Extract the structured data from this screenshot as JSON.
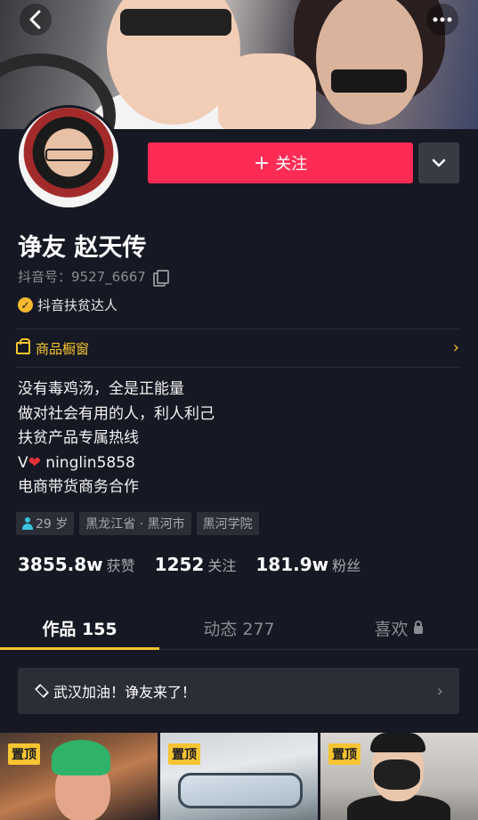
{
  "header": {
    "back_icon": "chevron-left-icon",
    "more_icon": "more-dots-icon"
  },
  "actions": {
    "follow_label": "关注",
    "dropdown_icon": "chevron-down-icon"
  },
  "profile": {
    "name": "诤友 赵天传",
    "douyin_id": "抖音号：9527_6667",
    "badge": "抖音扶贫达人",
    "shop_label": "商品橱窗",
    "bio_lines": [
      "没有毒鸡汤，全是正能量",
      "做对社会有用的人，利人利己",
      "扶贫产品专属热线",
      "V",
      "ninglin5858",
      "电商带货商务合作"
    ],
    "tags": {
      "age": "29 岁",
      "location": "黑龙江省 · 黑河市",
      "school": "黑河学院"
    },
    "stats": [
      {
        "value": "3855.8w",
        "label": "获赞"
      },
      {
        "value": "1252",
        "label": "关注"
      },
      {
        "value": "181.9w",
        "label": "粉丝"
      }
    ]
  },
  "tabs": [
    {
      "label": "作品 155",
      "active": true
    },
    {
      "label": "动态 277",
      "active": false
    },
    {
      "label": "喜欢",
      "active": false,
      "icon": "lock-icon"
    }
  ],
  "collection": {
    "title": "武汉加油！诤友来了！"
  },
  "videos": [
    {
      "pin": "置顶"
    },
    {
      "pin": "置顶"
    },
    {
      "pin": "置顶"
    }
  ],
  "colors": {
    "background": "#161823",
    "follow_button": "#fe2c55",
    "accent_yellow": "#f7c531"
  }
}
